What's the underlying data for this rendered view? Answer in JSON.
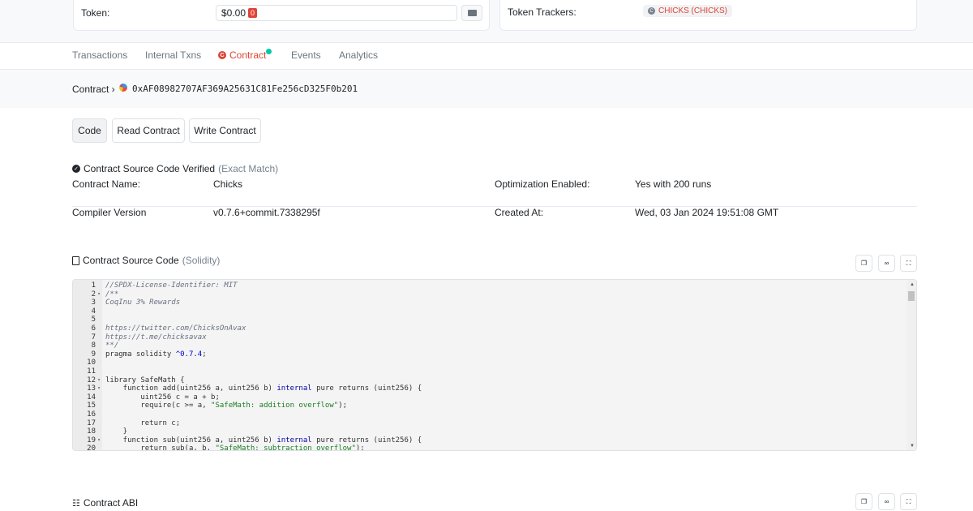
{
  "overview": {
    "token_label": "Token:",
    "token_value": "$0.00",
    "token_badge": "0",
    "trackers_label": "Token Trackers:",
    "tracker_chip": "CHICKS (CHICKS)"
  },
  "tabs": [
    {
      "label": "Transactions"
    },
    {
      "label": "Internal Txns"
    },
    {
      "label": "Contract",
      "active": true
    },
    {
      "label": "Events"
    },
    {
      "label": "Analytics"
    }
  ],
  "address": {
    "label": "Contract ›",
    "hash": "0xAF08982707AF369A25631C81Fe256cD325F0b201"
  },
  "sub_tabs": [
    {
      "label": "Code",
      "active": true
    },
    {
      "label": "Read Contract"
    },
    {
      "label": "Write Contract"
    }
  ],
  "verification": {
    "text": "Contract Source Code Verified",
    "match": "(Exact Match)"
  },
  "info": {
    "contract_name_label": "Contract Name:",
    "contract_name": "Chicks",
    "optimization_label": "Optimization Enabled:",
    "optimization": "Yes with 200 runs",
    "compiler_label": "Compiler Version",
    "compiler": "v0.7.6+commit.7338295f",
    "created_label": "Created At:",
    "created": "Wed, 03 Jan 2024 19:51:08 GMT"
  },
  "source": {
    "title": "Contract Source Code",
    "lang": "(Solidity)",
    "lines": [
      {
        "n": "1",
        "f": "",
        "t": "//SPDX-License-Identifier: MIT",
        "c": "cm"
      },
      {
        "n": "2",
        "f": "▾",
        "t": "/**",
        "c": "cm"
      },
      {
        "n": "3",
        "f": "",
        "t": "CoqInu 3% Rewards",
        "c": "cm"
      },
      {
        "n": "4",
        "f": "",
        "t": "",
        "c": ""
      },
      {
        "n": "5",
        "f": "",
        "t": "",
        "c": ""
      },
      {
        "n": "6",
        "f": "",
        "t": "https://twitter.com/ChicksOnAvax",
        "c": "cm"
      },
      {
        "n": "7",
        "f": "",
        "t": "https://t.me/chicksavax",
        "c": "cm"
      },
      {
        "n": "8",
        "f": "",
        "t": "**/",
        "c": "cm"
      },
      {
        "n": "9",
        "f": "",
        "t": "pragma solidity ^0.7.4;",
        "c": ""
      },
      {
        "n": "10",
        "f": "",
        "t": "",
        "c": ""
      },
      {
        "n": "11",
        "f": "",
        "t": "",
        "c": ""
      },
      {
        "n": "12",
        "f": "▾",
        "t": "library SafeMath {",
        "c": ""
      },
      {
        "n": "13",
        "f": "▾",
        "t": "    function add(uint256 a, uint256 b) internal pure returns (uint256) {",
        "c": ""
      },
      {
        "n": "14",
        "f": "",
        "t": "        uint256 c = a + b;",
        "c": ""
      },
      {
        "n": "15",
        "f": "",
        "t": "        require(c >= a, \"SafeMath: addition overflow\");",
        "c": ""
      },
      {
        "n": "16",
        "f": "",
        "t": "",
        "c": ""
      },
      {
        "n": "17",
        "f": "",
        "t": "        return c;",
        "c": ""
      },
      {
        "n": "18",
        "f": "",
        "t": "    }",
        "c": ""
      },
      {
        "n": "19",
        "f": "▾",
        "t": "    function sub(uint256 a, uint256 b) internal pure returns (uint256) {",
        "c": ""
      },
      {
        "n": "20",
        "f": "",
        "t": "        return sub(a, b, \"SafeMath: subtraction overflow\");",
        "c": ""
      }
    ]
  },
  "abi": {
    "title": "Contract ABI"
  },
  "icons": {
    "copy": "copy-icon",
    "link": "link-icon",
    "fullscreen": "fullscreen-icon"
  }
}
